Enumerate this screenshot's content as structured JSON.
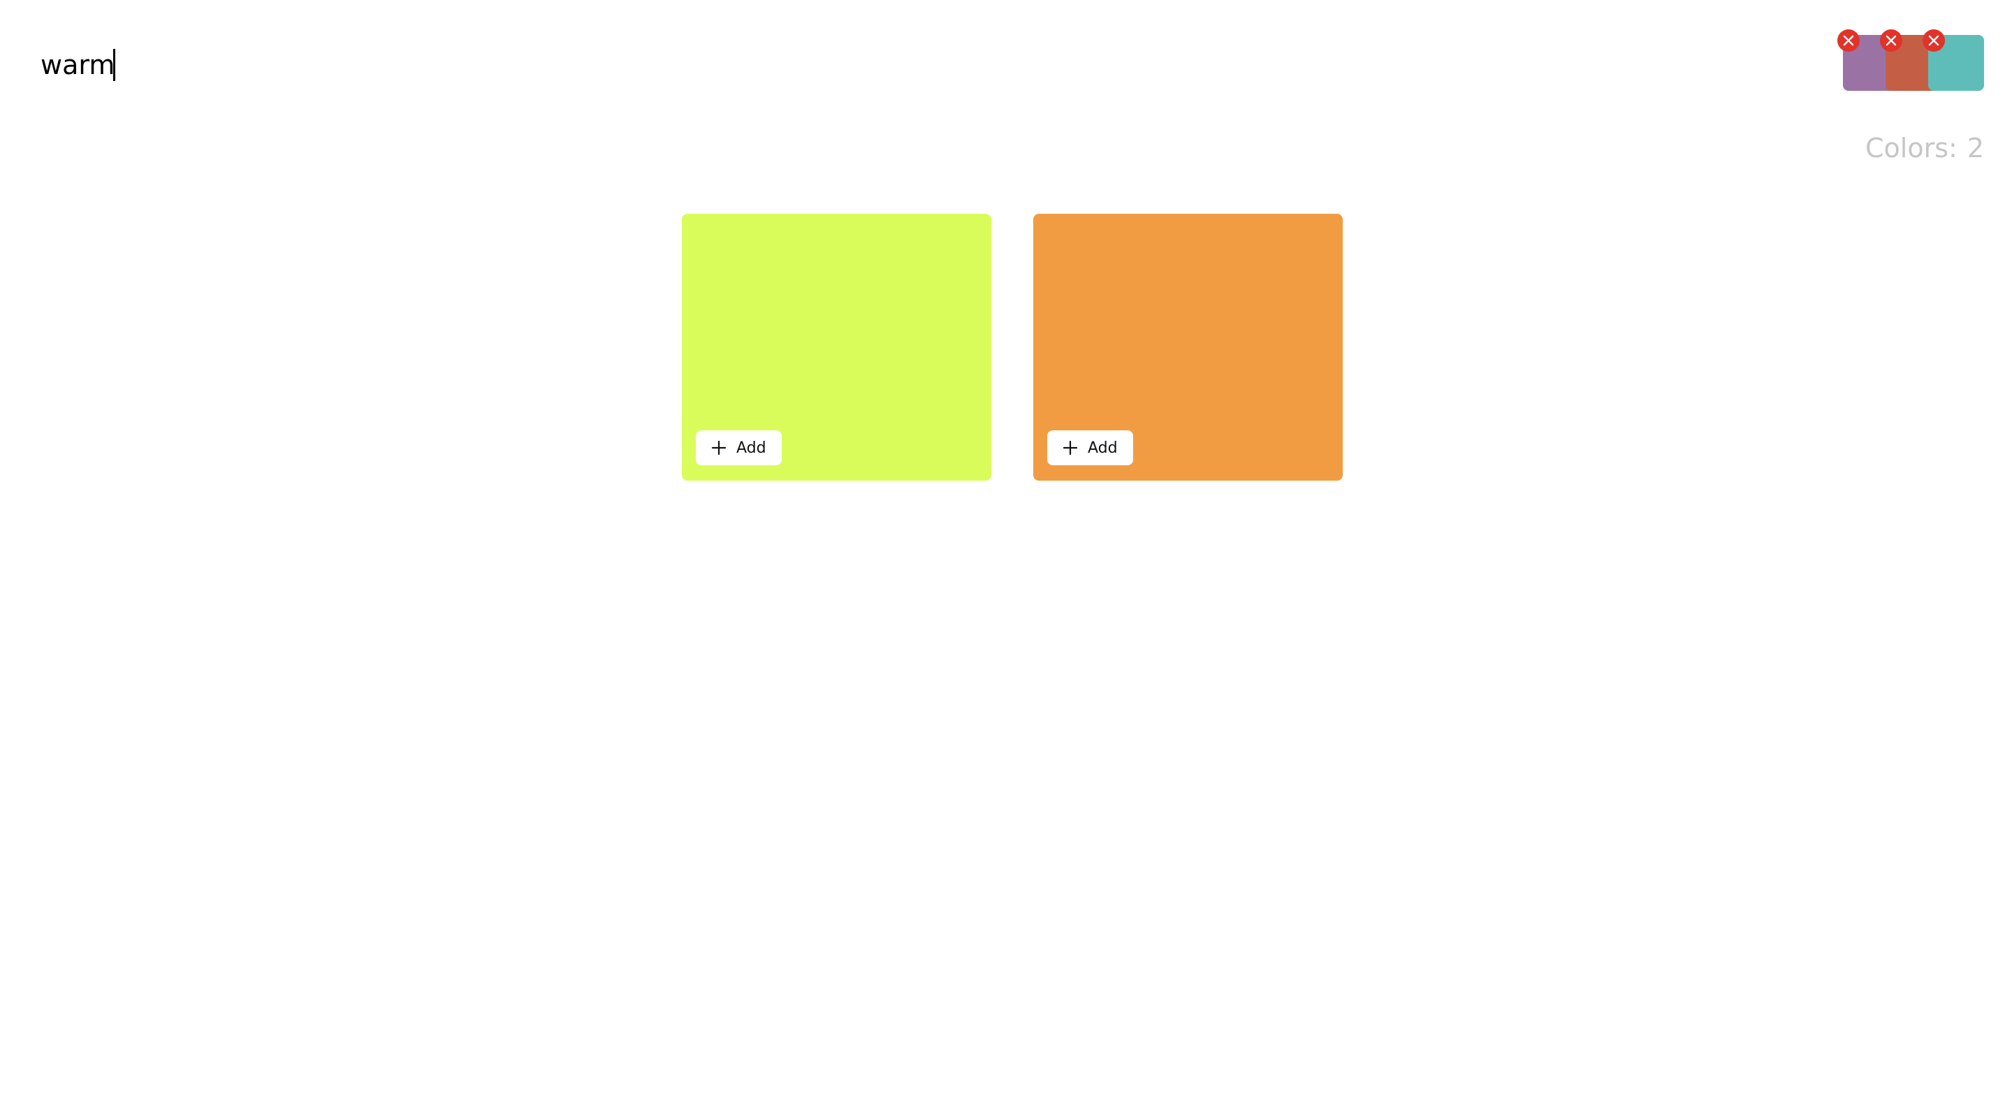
{
  "search": {
    "value": "warm"
  },
  "palette": {
    "swatches": [
      {
        "color": "#9B72A4",
        "remove_icon": "close-icon",
        "remove_color": "#E0332A"
      },
      {
        "color": "#C45F45",
        "remove_icon": "close-icon",
        "remove_color": "#E0332A"
      },
      {
        "color": "#5FBDB9",
        "remove_icon": "close-icon",
        "remove_color": "#E0332A"
      }
    ]
  },
  "colors_count": {
    "label": "Colors:",
    "value": "2"
  },
  "results": [
    {
      "color": "#D9FC5A",
      "add_label": "Add",
      "add_icon": "plus-icon"
    },
    {
      "color": "#F19C42",
      "add_label": "Add",
      "add_icon": "plus-icon"
    }
  ]
}
